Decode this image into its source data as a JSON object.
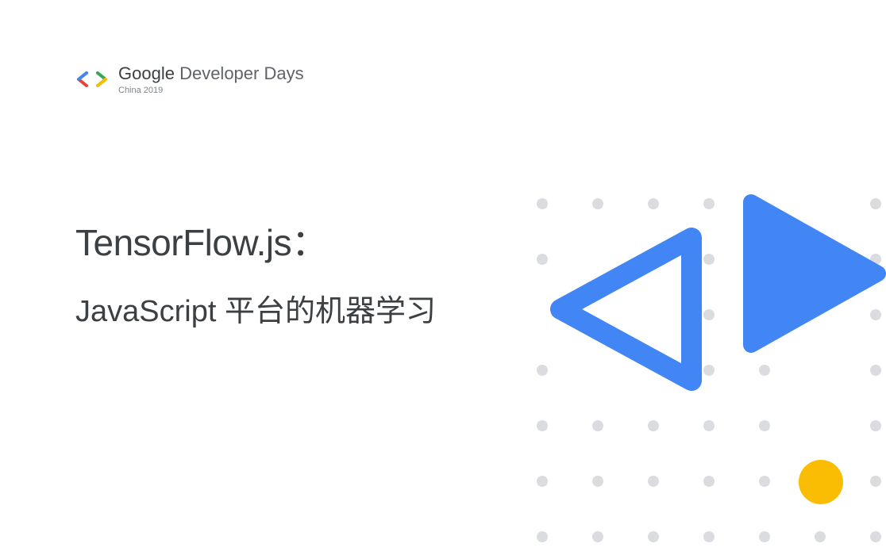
{
  "header": {
    "brand": "Google",
    "event": "Developer Days",
    "subtitle": "China 2019"
  },
  "title": {
    "line1": "TensorFlow.js：",
    "line2": "JavaScript 平台的机器学习"
  },
  "colors": {
    "google_blue": "#4285f4",
    "google_red": "#ea4335",
    "google_yellow": "#fbbc04",
    "google_green": "#34a853",
    "text_dark": "#3c4043",
    "text_gray": "#5f6368",
    "dot_gray": "#dadce0"
  }
}
